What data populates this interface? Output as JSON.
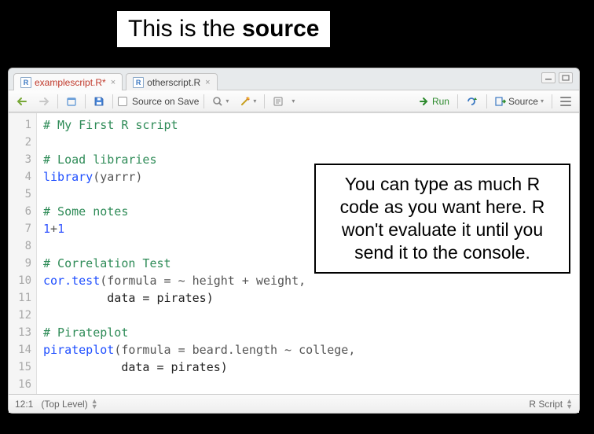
{
  "caption": {
    "prefix": "This is the ",
    "emphasis": "source"
  },
  "tabs": [
    {
      "label": "examplescript.R*",
      "active": true
    },
    {
      "label": "otherscript.R",
      "active": false
    }
  ],
  "toolbar": {
    "source_on_save": "Source on Save",
    "run": "Run",
    "source": "Source"
  },
  "code_lines": [
    {
      "n": 1,
      "tokens": [
        {
          "cls": "c-comment",
          "t": "# My First R script"
        }
      ]
    },
    {
      "n": 2,
      "tokens": []
    },
    {
      "n": 3,
      "tokens": [
        {
          "cls": "c-comment",
          "t": "# Load libraries"
        }
      ]
    },
    {
      "n": 4,
      "tokens": [
        {
          "cls": "c-func",
          "t": "library"
        },
        {
          "cls": "c-paren",
          "t": "(yarrr)"
        }
      ]
    },
    {
      "n": 5,
      "tokens": []
    },
    {
      "n": 6,
      "tokens": [
        {
          "cls": "c-comment",
          "t": "# Some notes"
        }
      ]
    },
    {
      "n": 7,
      "tokens": [
        {
          "cls": "c-num",
          "t": "1"
        },
        {
          "cls": "c-op",
          "t": "+"
        },
        {
          "cls": "c-num",
          "t": "1"
        }
      ]
    },
    {
      "n": 8,
      "tokens": []
    },
    {
      "n": 9,
      "tokens": [
        {
          "cls": "c-comment",
          "t": "# Correlation Test"
        }
      ]
    },
    {
      "n": 10,
      "tokens": [
        {
          "cls": "c-func",
          "t": "cor.test"
        },
        {
          "cls": "c-paren",
          "t": "(formula = ~ height + weight,"
        }
      ]
    },
    {
      "n": 11,
      "tokens": [
        {
          "cls": "",
          "t": "         data = pirates)"
        }
      ]
    },
    {
      "n": 12,
      "tokens": []
    },
    {
      "n": 13,
      "tokens": [
        {
          "cls": "c-comment",
          "t": "# Pirateplot"
        }
      ]
    },
    {
      "n": 14,
      "tokens": [
        {
          "cls": "c-func",
          "t": "pirateplot"
        },
        {
          "cls": "c-paren",
          "t": "(formula = beard.length ~ college,"
        }
      ]
    },
    {
      "n": 15,
      "tokens": [
        {
          "cls": "",
          "t": "           data = pirates)"
        }
      ]
    },
    {
      "n": 16,
      "tokens": []
    }
  ],
  "status": {
    "pos": "12:1",
    "scope": "(Top Level)",
    "lang": "R Script"
  },
  "note": "You can type as much R code as you want here. R won't evaluate it until you send it to the console."
}
